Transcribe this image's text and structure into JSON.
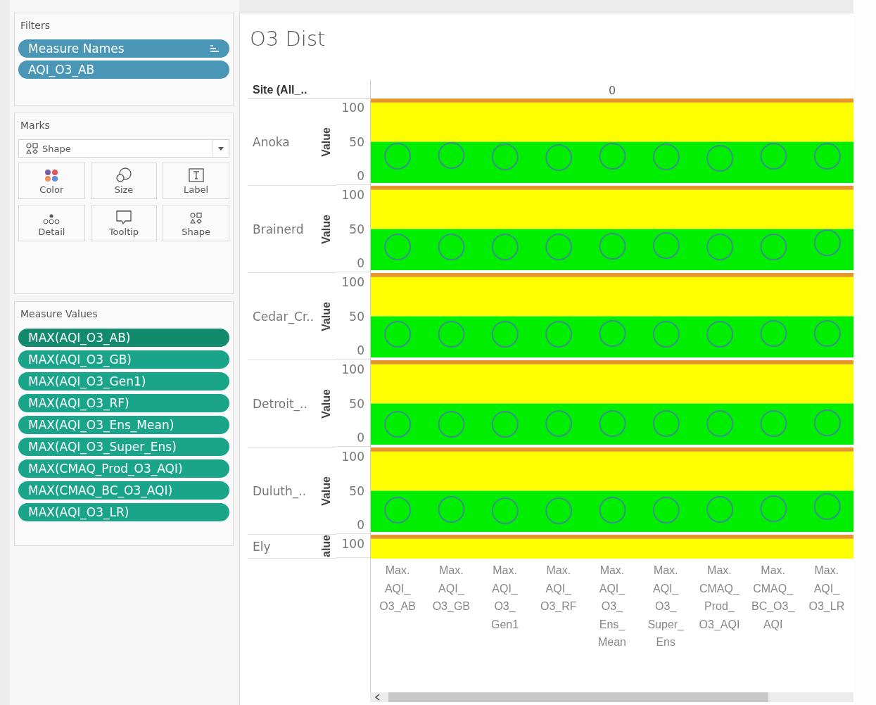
{
  "filters": {
    "title": "Filters",
    "pills": [
      {
        "label": "Measure Names",
        "sorted": true
      },
      {
        "label": "AQI_O3_AB",
        "sorted": false
      }
    ]
  },
  "marks": {
    "title": "Marks",
    "mark_type": "Shape",
    "cards": [
      {
        "kind": "color",
        "label": "Color"
      },
      {
        "kind": "size",
        "label": "Size"
      },
      {
        "kind": "label",
        "label": "Label"
      },
      {
        "kind": "detail",
        "label": "Detail"
      },
      {
        "kind": "tooltip",
        "label": "Tooltip"
      },
      {
        "kind": "shape",
        "label": "Shape"
      }
    ]
  },
  "measure_values": {
    "title": "Measure Values",
    "pills": [
      {
        "label": "MAX(AQI_O3_AB)",
        "selected": true
      },
      {
        "label": "MAX(AQI_O3_GB)",
        "selected": false
      },
      {
        "label": "MAX(AQI_O3_Gen1)",
        "selected": false
      },
      {
        "label": "MAX(AQI_O3_RF)",
        "selected": false
      },
      {
        "label": "MAX(AQI_O3_Ens_Mean)",
        "selected": false
      },
      {
        "label": "MAX(AQI_O3_Super_Ens)",
        "selected": false
      },
      {
        "label": "MAX(CMAQ_Prod_O3_AQI)",
        "selected": false
      },
      {
        "label": "MAX(CMAQ_BC_O3_AQI)",
        "selected": false
      },
      {
        "label": "MAX(AQI_O3_LR)",
        "selected": false
      }
    ]
  },
  "view": {
    "title": "O3 Dist",
    "row_header": "Site (All_..",
    "column_header": "0",
    "panes": [
      {
        "site": "Anoka",
        "axis_title": "Value",
        "tick_labels": [
          "100",
          "50",
          "0"
        ]
      },
      {
        "site": "Brainerd",
        "axis_title": "Value",
        "tick_labels": [
          "100",
          "50",
          "0"
        ]
      },
      {
        "site": "Cedar_Cr..",
        "axis_title": "Value",
        "tick_labels": [
          "100",
          "50",
          "0"
        ]
      },
      {
        "site": "Detroit_..",
        "axis_title": "Value",
        "tick_labels": [
          "100",
          "50",
          "0"
        ]
      },
      {
        "site": "Duluth_..",
        "axis_title": "Value",
        "tick_labels": [
          "100",
          "50",
          "0"
        ]
      },
      {
        "site": "Ely",
        "axis_title": "alue",
        "tick_labels": [
          "100"
        ]
      }
    ],
    "categories": [
      "Max.\nAQI_\nO3_AB",
      "Max.\nAQI_\nO3_GB",
      "Max.\nAQI_\nO3_\nGen1",
      "Max.\nAQI_\nO3_RF",
      "Max.\nAQI_\nO3_\nEns_\nMean",
      "Max.\nAQI_\nO3_\nSuper_\nEns",
      "Max.\nCMAQ_\nProd_\nO3_AQI",
      "Max.\nCMAQ_\nBC_O3_\nAQI",
      "Max.\nAQI_\nO3_LR"
    ]
  }
}
